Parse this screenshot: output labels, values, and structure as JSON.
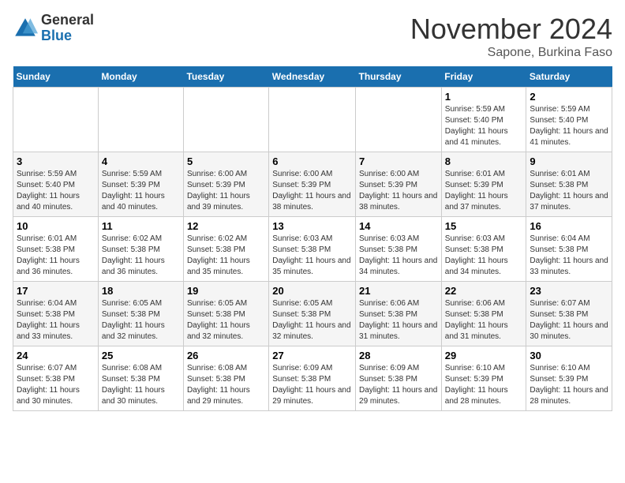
{
  "header": {
    "logo_general": "General",
    "logo_blue": "Blue",
    "month_title": "November 2024",
    "location": "Sapone, Burkina Faso"
  },
  "weekdays": [
    "Sunday",
    "Monday",
    "Tuesday",
    "Wednesday",
    "Thursday",
    "Friday",
    "Saturday"
  ],
  "weeks": [
    [
      {
        "day": "",
        "info": ""
      },
      {
        "day": "",
        "info": ""
      },
      {
        "day": "",
        "info": ""
      },
      {
        "day": "",
        "info": ""
      },
      {
        "day": "",
        "info": ""
      },
      {
        "day": "1",
        "info": "Sunrise: 5:59 AM\nSunset: 5:40 PM\nDaylight: 11 hours and 41 minutes."
      },
      {
        "day": "2",
        "info": "Sunrise: 5:59 AM\nSunset: 5:40 PM\nDaylight: 11 hours and 41 minutes."
      }
    ],
    [
      {
        "day": "3",
        "info": "Sunrise: 5:59 AM\nSunset: 5:40 PM\nDaylight: 11 hours and 40 minutes."
      },
      {
        "day": "4",
        "info": "Sunrise: 5:59 AM\nSunset: 5:39 PM\nDaylight: 11 hours and 40 minutes."
      },
      {
        "day": "5",
        "info": "Sunrise: 6:00 AM\nSunset: 5:39 PM\nDaylight: 11 hours and 39 minutes."
      },
      {
        "day": "6",
        "info": "Sunrise: 6:00 AM\nSunset: 5:39 PM\nDaylight: 11 hours and 38 minutes."
      },
      {
        "day": "7",
        "info": "Sunrise: 6:00 AM\nSunset: 5:39 PM\nDaylight: 11 hours and 38 minutes."
      },
      {
        "day": "8",
        "info": "Sunrise: 6:01 AM\nSunset: 5:39 PM\nDaylight: 11 hours and 37 minutes."
      },
      {
        "day": "9",
        "info": "Sunrise: 6:01 AM\nSunset: 5:38 PM\nDaylight: 11 hours and 37 minutes."
      }
    ],
    [
      {
        "day": "10",
        "info": "Sunrise: 6:01 AM\nSunset: 5:38 PM\nDaylight: 11 hours and 36 minutes."
      },
      {
        "day": "11",
        "info": "Sunrise: 6:02 AM\nSunset: 5:38 PM\nDaylight: 11 hours and 36 minutes."
      },
      {
        "day": "12",
        "info": "Sunrise: 6:02 AM\nSunset: 5:38 PM\nDaylight: 11 hours and 35 minutes."
      },
      {
        "day": "13",
        "info": "Sunrise: 6:03 AM\nSunset: 5:38 PM\nDaylight: 11 hours and 35 minutes."
      },
      {
        "day": "14",
        "info": "Sunrise: 6:03 AM\nSunset: 5:38 PM\nDaylight: 11 hours and 34 minutes."
      },
      {
        "day": "15",
        "info": "Sunrise: 6:03 AM\nSunset: 5:38 PM\nDaylight: 11 hours and 34 minutes."
      },
      {
        "day": "16",
        "info": "Sunrise: 6:04 AM\nSunset: 5:38 PM\nDaylight: 11 hours and 33 minutes."
      }
    ],
    [
      {
        "day": "17",
        "info": "Sunrise: 6:04 AM\nSunset: 5:38 PM\nDaylight: 11 hours and 33 minutes."
      },
      {
        "day": "18",
        "info": "Sunrise: 6:05 AM\nSunset: 5:38 PM\nDaylight: 11 hours and 32 minutes."
      },
      {
        "day": "19",
        "info": "Sunrise: 6:05 AM\nSunset: 5:38 PM\nDaylight: 11 hours and 32 minutes."
      },
      {
        "day": "20",
        "info": "Sunrise: 6:05 AM\nSunset: 5:38 PM\nDaylight: 11 hours and 32 minutes."
      },
      {
        "day": "21",
        "info": "Sunrise: 6:06 AM\nSunset: 5:38 PM\nDaylight: 11 hours and 31 minutes."
      },
      {
        "day": "22",
        "info": "Sunrise: 6:06 AM\nSunset: 5:38 PM\nDaylight: 11 hours and 31 minutes."
      },
      {
        "day": "23",
        "info": "Sunrise: 6:07 AM\nSunset: 5:38 PM\nDaylight: 11 hours and 30 minutes."
      }
    ],
    [
      {
        "day": "24",
        "info": "Sunrise: 6:07 AM\nSunset: 5:38 PM\nDaylight: 11 hours and 30 minutes."
      },
      {
        "day": "25",
        "info": "Sunrise: 6:08 AM\nSunset: 5:38 PM\nDaylight: 11 hours and 30 minutes."
      },
      {
        "day": "26",
        "info": "Sunrise: 6:08 AM\nSunset: 5:38 PM\nDaylight: 11 hours and 29 minutes."
      },
      {
        "day": "27",
        "info": "Sunrise: 6:09 AM\nSunset: 5:38 PM\nDaylight: 11 hours and 29 minutes."
      },
      {
        "day": "28",
        "info": "Sunrise: 6:09 AM\nSunset: 5:38 PM\nDaylight: 11 hours and 29 minutes."
      },
      {
        "day": "29",
        "info": "Sunrise: 6:10 AM\nSunset: 5:39 PM\nDaylight: 11 hours and 28 minutes."
      },
      {
        "day": "30",
        "info": "Sunrise: 6:10 AM\nSunset: 5:39 PM\nDaylight: 11 hours and 28 minutes."
      }
    ]
  ]
}
